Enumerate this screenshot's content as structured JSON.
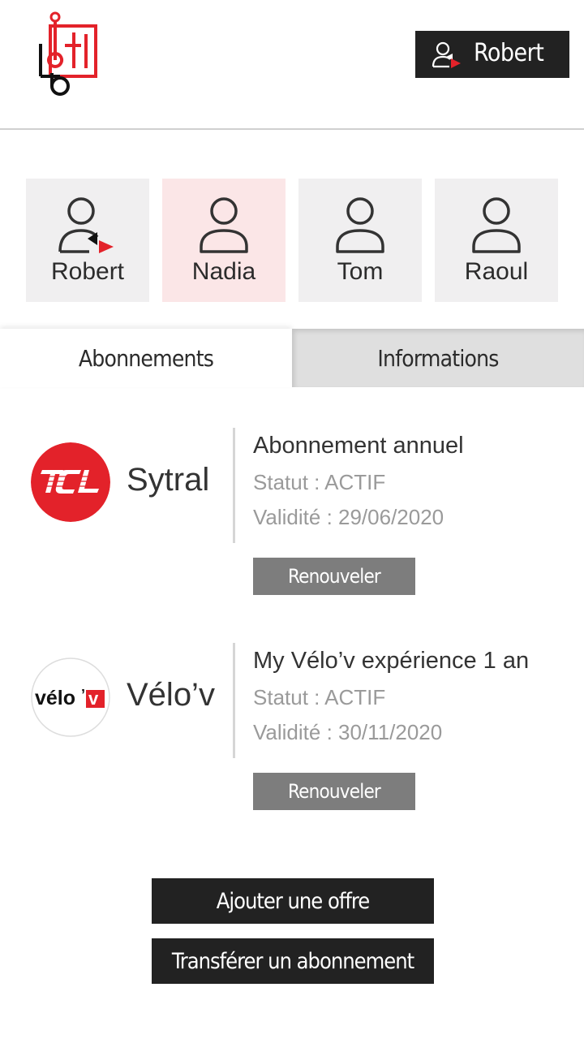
{
  "header": {
    "logo_text": "tbl",
    "user_button_label": "Robert"
  },
  "profiles": [
    {
      "name": "Robert",
      "active": false,
      "current_user": true
    },
    {
      "name": "Nadia",
      "active": true,
      "current_user": false
    },
    {
      "name": "Tom",
      "active": false,
      "current_user": false
    },
    {
      "name": "Raoul",
      "active": false,
      "current_user": false
    }
  ],
  "tabs": [
    {
      "label": "Abonnements",
      "active": true
    },
    {
      "label": "Informations",
      "active": false
    }
  ],
  "subscriptions": [
    {
      "brand": "Sytral",
      "logo_text": "TCL",
      "title": "Abonnement annuel",
      "status": "Statut : ACTIF",
      "validity": "Validité : 29/06/2020",
      "button": "Renouveler"
    },
    {
      "brand": "Vélo’v",
      "logo_text": "vélo’v",
      "title": "My Vélo’v expérience 1 an",
      "status": "Statut : ACTIF",
      "validity": "Validité : 30/11/2020",
      "button": "Renouveler"
    }
  ],
  "actions": {
    "add_offer": "Ajouter une offre",
    "transfer": "Transférer un abonnement"
  },
  "colors": {
    "accent_red": "#e3222a",
    "dark": "#222222",
    "profile_bg": "#f0eff0",
    "profile_active_bg": "#fbe6e7",
    "button_grey": "#7d7d7d"
  }
}
